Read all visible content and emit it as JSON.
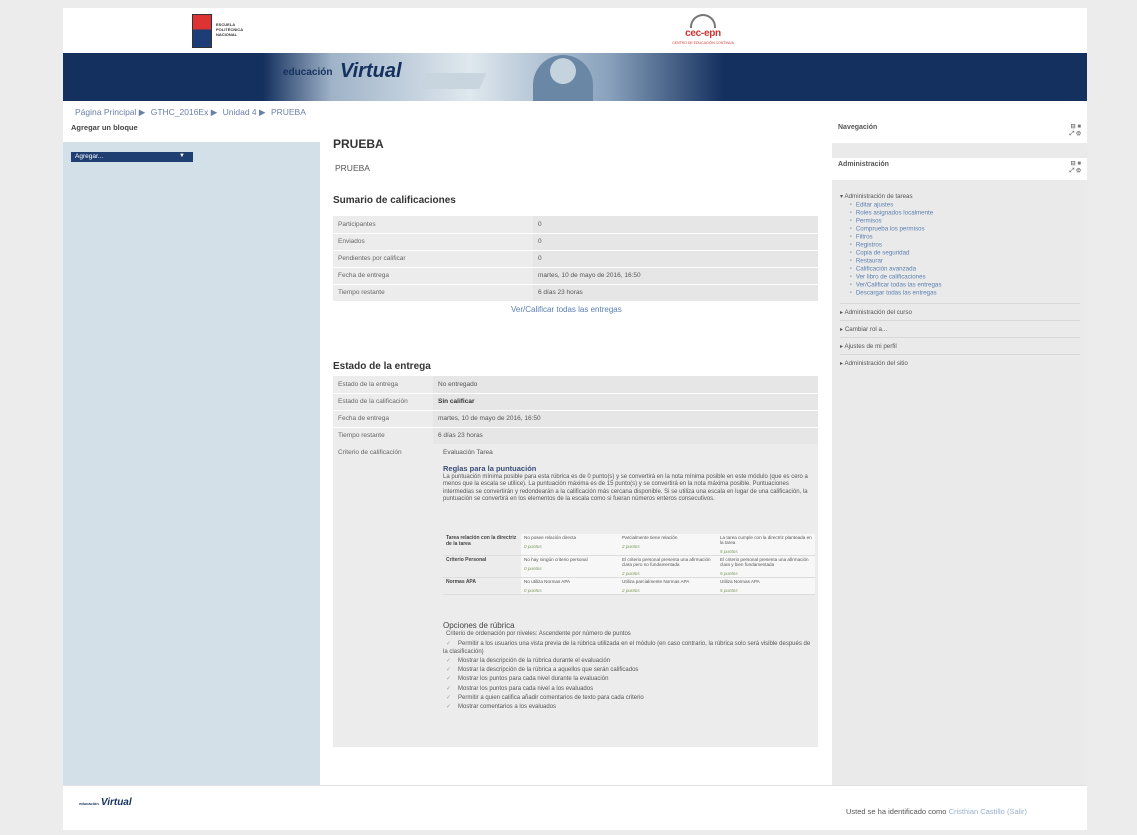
{
  "header": {
    "epn_logo_text": "ESCUELA POLITÉCNICA NACIONAL",
    "cec_logo_name": "cec-epn",
    "cec_logo_sub": "CENTRO DE EDUCACIÓN CONTINUA",
    "brand_prefix": "educación",
    "brand_name": "Virtual"
  },
  "breadcrumb": [
    "Página Principal ▶",
    "GTHC_2016Ex ▶",
    "Unidad 4 ▶",
    "PRUEBA"
  ],
  "left_block": {
    "title": "Agregar un bloque",
    "select_value": "Agregar..."
  },
  "main": {
    "title": "PRUEBA",
    "description": "PRUEBA",
    "summary_title": "Sumario de calificaciones",
    "summary_rows": [
      {
        "k": "Participantes",
        "v": "0"
      },
      {
        "k": "Enviados",
        "v": "0"
      },
      {
        "k": "Pendientes por calificar",
        "v": "0"
      },
      {
        "k": "Fecha de entrega",
        "v": "martes, 10 de mayo de 2016, 16:50"
      },
      {
        "k": "Tiempo restante",
        "v": "6 días 23 horas"
      }
    ],
    "grade_link": "Ver/Calificar todas las entregas",
    "status_title": "Estado de la entrega",
    "status_rows": [
      {
        "k": "Estado de la entrega",
        "v": "No entregado"
      },
      {
        "k": "Estado de la calificación",
        "v": "Sin calificar"
      },
      {
        "k": "Fecha de entrega",
        "v": "martes, 10 de mayo de 2016, 16:50"
      },
      {
        "k": "Tiempo restante",
        "v": "6 días 23 horas"
      }
    ],
    "criteria_key": "Criterio de calificación",
    "criteria_value": "Evaluación Tarea",
    "rules_title": "Reglas para la puntuación",
    "rules_text": "La puntuación mínima posible para esta rúbrica es de 0 punto(s) y se convertirá en la nota mínima posible en este módulo (que es cero a menos que la escala se utilice). La puntuación máxima es de 15 punto(s) y se convertirá en la nota máxima posible. Puntuaciones intermedias se convertirán y redondearán a la calificación más cercana disponible. Si se utiliza una escala en lugar de una calificación, la puntuación se convertirá en los elementos de la escala como si fueran números enteros consecutivos.",
    "rubric": [
      {
        "criterion": "Tarea relación con la directriz de la tarea",
        "levels": [
          {
            "d": "No posee relación directa",
            "p": "0 puntos"
          },
          {
            "d": "Parcialmente tiene relación",
            "p": "2 puntos"
          },
          {
            "d": "La tarea cumple con la directriz planteada en la tarea",
            "p": "5 puntos"
          }
        ]
      },
      {
        "criterion": "Criterio Personal",
        "levels": [
          {
            "d": "No hay ningún criterio personal",
            "p": "0 puntos"
          },
          {
            "d": "El criterio personal presenta una afirmación clara pero no fundamentada",
            "p": "2 puntos"
          },
          {
            "d": "El criterio personal presenta una afirmación clara y bien fundamentada",
            "p": "5 puntos"
          }
        ]
      },
      {
        "criterion": "Normas APA",
        "levels": [
          {
            "d": "No utiliza Normas APA",
            "p": "0 puntos"
          },
          {
            "d": "Utiliza parcialmente Normas APA",
            "p": "2 puntos"
          },
          {
            "d": "Utiliza Normas APA",
            "p": "5 puntos"
          }
        ]
      }
    ],
    "options_title": "Opciones de rúbrica",
    "options_sort_label": "Criterio de ordenación por niveles:",
    "options_sort_value": "Ascendente por número de puntos",
    "options": [
      "Permitir a los usuarios una vista previa de la rúbrica utilizada en el módulo (en caso contrario, la rúbrica solo será visible después de la clasificación)",
      "Mostrar la descripción de la rúbrica durante el evaluación",
      "Mostrar la descripción de la rúbrica a aquellos que serán calificados",
      "Mostrar los puntos para cada nivel durante la evaluación",
      "Mostrar los puntos para cada nivel a los evaluados",
      "Permitir a quien califica añadir comentarios de texto para cada criterio",
      "Mostrar comentarios a los evaluados"
    ]
  },
  "right": {
    "nav_title": "Navegación",
    "admin_title": "Administración",
    "tree_parent": "Administración de tareas",
    "tree_items": [
      "Editar ajustes",
      "Roles asignados localmente",
      "Permisos",
      "Comprueba los permisos",
      "Filtros",
      "Registros",
      "Copia de seguridad",
      "Restaurar",
      "Calificación avanzada",
      "Ver libro de calificaciones",
      "Ver/Calificar todas las entregas",
      "Descargar todas las entregas"
    ],
    "sections": [
      "Administración del curso",
      "Cambiar rol a...",
      "Ajustes de mi perfil",
      "Administración del sitio"
    ]
  },
  "footer": {
    "logo_prefix": "educación",
    "logo_name": "Virtual",
    "login_text": "Usted se ha identificado como",
    "user_name": "Cristhian Castillo",
    "logout": "(Salir)"
  },
  "colors": {
    "banner": "#14305e",
    "link": "#5a7fb0",
    "left_panel": "#d4e0e8"
  }
}
